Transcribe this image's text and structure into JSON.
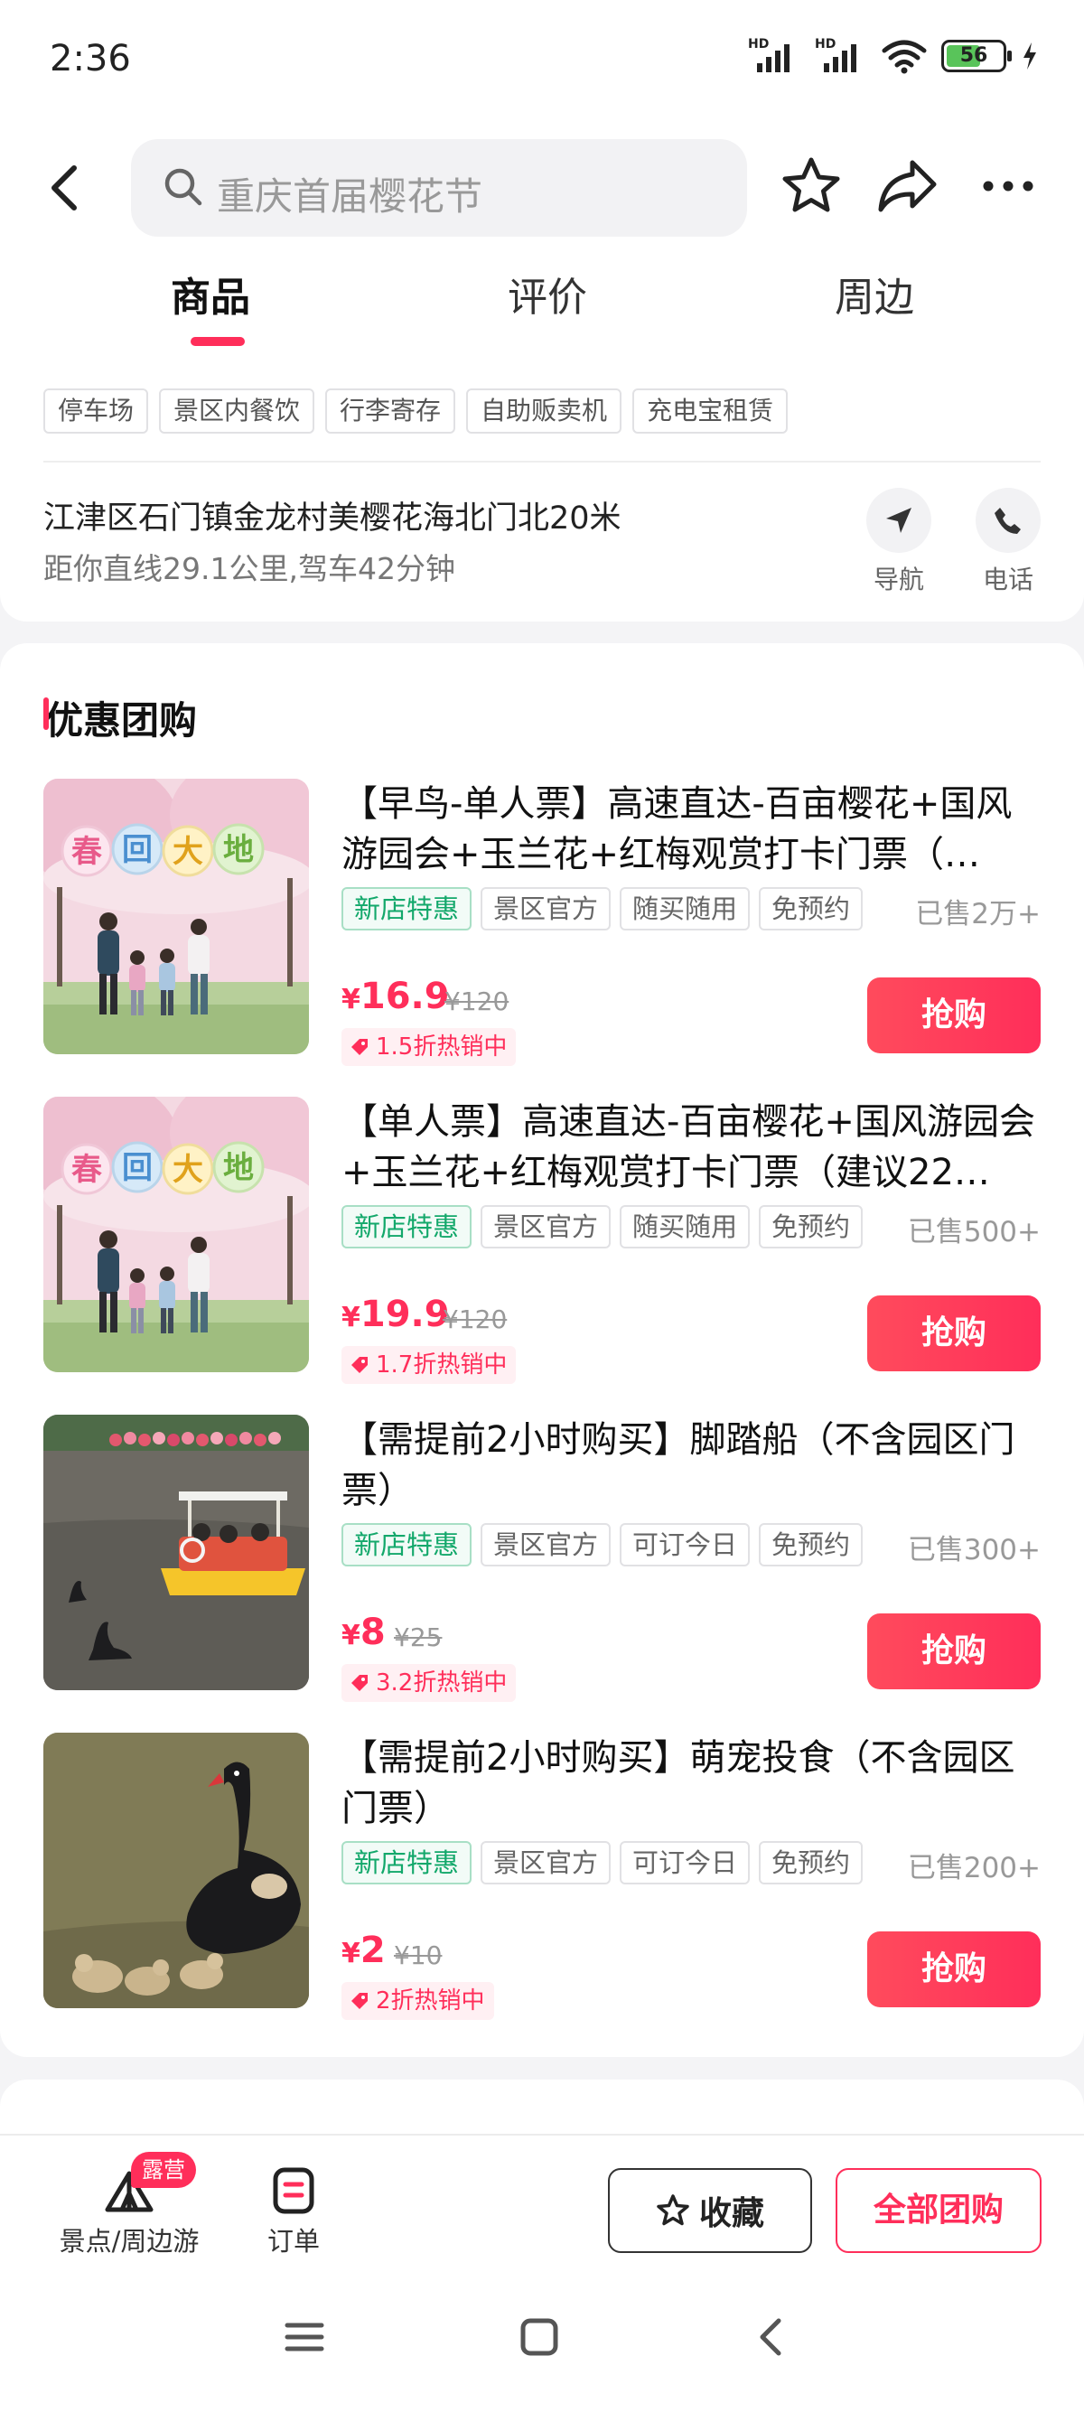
{
  "status_bar": {
    "time": "2:36",
    "battery": "56",
    "hd": "HD"
  },
  "search": {
    "placeholder": "重庆首届樱花节"
  },
  "tabs": [
    {
      "label": "商品",
      "active": true
    },
    {
      "label": "评价",
      "active": false
    },
    {
      "label": "周边",
      "active": false
    }
  ],
  "facilities": [
    "停车场",
    "景区内餐饮",
    "行李寄存",
    "自助贩卖机",
    "充电宝租赁"
  ],
  "location": {
    "address": "江津区石门镇金龙村美樱花海北门北20米",
    "distance": "距你直线29.1公里,驾车42分钟",
    "nav_label": "导航",
    "phone_label": "电话"
  },
  "deals_section": {
    "title": "优惠团购",
    "items": [
      {
        "title": "【早鸟-单人票】高速直达-百亩樱花+国风游园会+玉兰花+红梅观赏打卡门票（…",
        "tags": [
          "新店特惠",
          "景区官方",
          "随买随用",
          "免预约"
        ],
        "sold": "已售2万+",
        "currency": "¥",
        "price": "16.9",
        "original": "¥120",
        "hot": "1.5折热销中",
        "buy_label": "抢购",
        "image_text": "春回大地"
      },
      {
        "title": "【单人票】高速直达-百亩樱花+国风游园会+玉兰花+红梅观赏打卡门票（建议22…",
        "tags": [
          "新店特惠",
          "景区官方",
          "随买随用",
          "免预约"
        ],
        "sold": "已售500+",
        "currency": "¥",
        "price": "19.9",
        "original": "¥120",
        "hot": "1.7折热销中",
        "buy_label": "抢购",
        "image_text": "春回大地"
      },
      {
        "title": "【需提前2小时购买】脚踏船（不含园区门票）",
        "tags": [
          "新店特惠",
          "景区官方",
          "可订今日",
          "免预约"
        ],
        "sold": "已售300+",
        "currency": "¥",
        "price": "8",
        "original": "¥25",
        "hot": "3.2折热销中",
        "buy_label": "抢购",
        "image_text": ""
      },
      {
        "title": "【需提前2小时购买】萌宠投食（不含园区门票）",
        "tags": [
          "新店特惠",
          "景区官方",
          "可订今日",
          "免预约"
        ],
        "sold": "已售200+",
        "currency": "¥",
        "price": "2",
        "original": "¥10",
        "hot": "2折热销中",
        "buy_label": "抢购",
        "image_text": ""
      }
    ]
  },
  "bottom_bar": {
    "nearby_label": "景点/周边游",
    "nearby_badge": "露营",
    "orders_label": "订单",
    "favorite_label": "收藏",
    "all_deals_label": "全部团购"
  },
  "colors": {
    "accent": "#ff2e5a",
    "green_tag": "#13a86b"
  }
}
